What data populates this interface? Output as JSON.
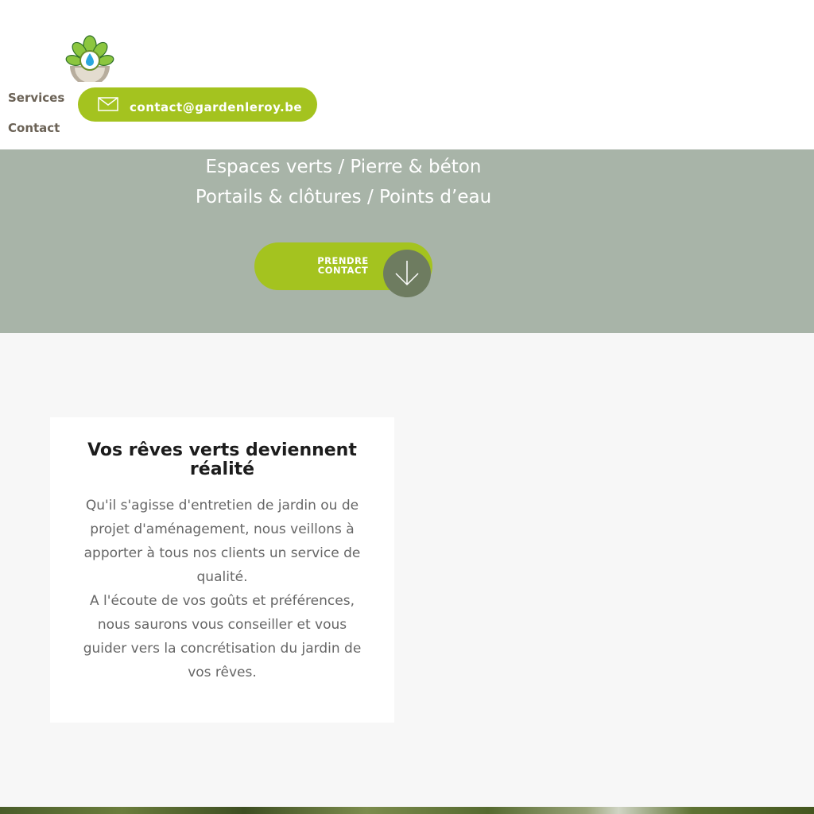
{
  "header": {
    "nav": [
      {
        "label": "Services"
      },
      {
        "label": "Contact"
      }
    ],
    "email": "contact@gardenleroy.be"
  },
  "hero": {
    "line1": "Espaces verts / Pierre & béton",
    "line2": "Portails & clôtures / Points d’eau",
    "cta_label": "PRENDRE CONTACT"
  },
  "intro": {
    "title": "Vos rêves verts deviennent réalité",
    "paragraph1": "Qu'il s'agisse d'entretien de jardin ou de projet d'aménagement, nous veillons à apporter à tous nos clients un service de qualité.",
    "paragraph2": "A l'écoute de vos goûts et préférences, nous saurons vous conseiller et vous guider vers la concrétisation du jardin de vos rêves."
  },
  "colors": {
    "accent": "#a4c31f",
    "hero_bg": "#a8b4a8",
    "nav_text": "#6b6256",
    "cta_circle": "#6e7c60"
  },
  "icons": [
    "garden-logo",
    "mail-icon",
    "arrow-down-icon"
  ]
}
